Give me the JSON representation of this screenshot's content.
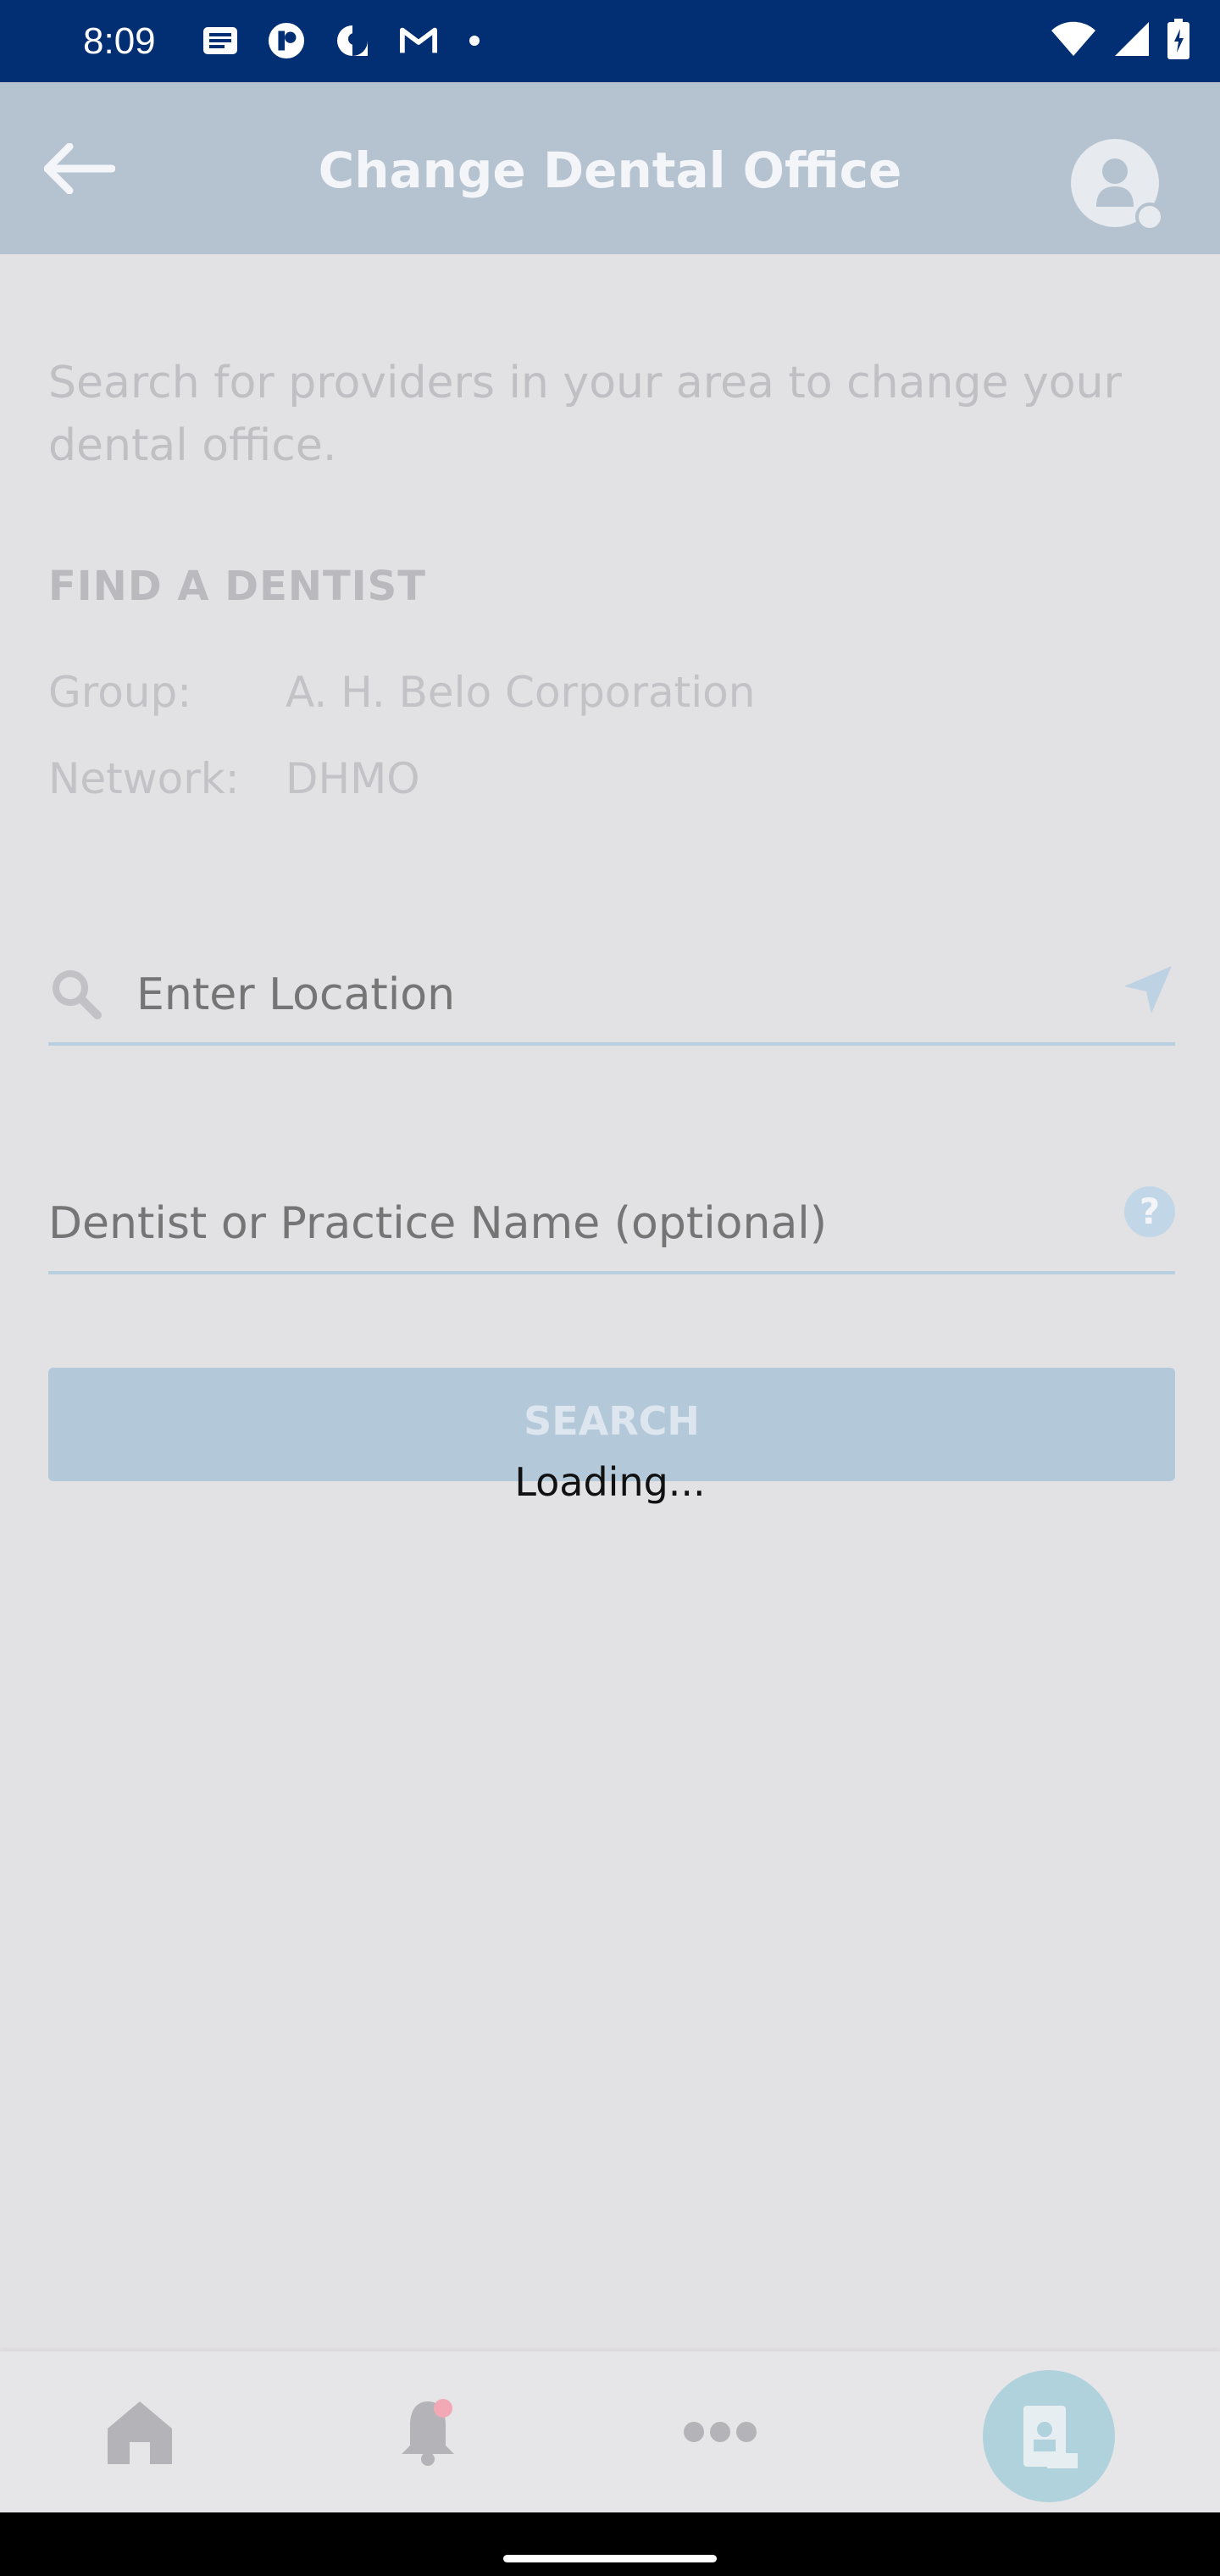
{
  "status_bar": {
    "time": "8:09",
    "left_icons": [
      "news-icon",
      "app-icon",
      "messenger-icon",
      "gmail-icon",
      "dot-icon"
    ],
    "right_icons": [
      "wifi-icon",
      "signal-icon",
      "battery-icon"
    ]
  },
  "header": {
    "title": "Change Dental Office",
    "back_icon": "arrow-left-icon",
    "profile_icon": "profile-avatar-icon"
  },
  "intro": {
    "text": "Search for providers in your area to change your dental office."
  },
  "find_dentist": {
    "title": "FIND A DENTIST",
    "group_label": "Group:",
    "group_value": "A. H. Belo Corporation",
    "network_label": "Network:",
    "network_value": "DHMO"
  },
  "search": {
    "location_placeholder": "Enter Location",
    "location_value": "",
    "name_placeholder": "Dentist or Practice Name (optional)",
    "name_value": "",
    "button_label": "SEARCH"
  },
  "overlay": {
    "loading_text": "Loading..."
  },
  "bottom_nav": {
    "items": [
      "home-icon",
      "bell-icon",
      "more-icon",
      "id-card-icon"
    ]
  },
  "colors": {
    "status_bar": "#022f73",
    "header": "#b5c2cf",
    "background": "#e2e1e4",
    "accent": "#b3c9da"
  }
}
